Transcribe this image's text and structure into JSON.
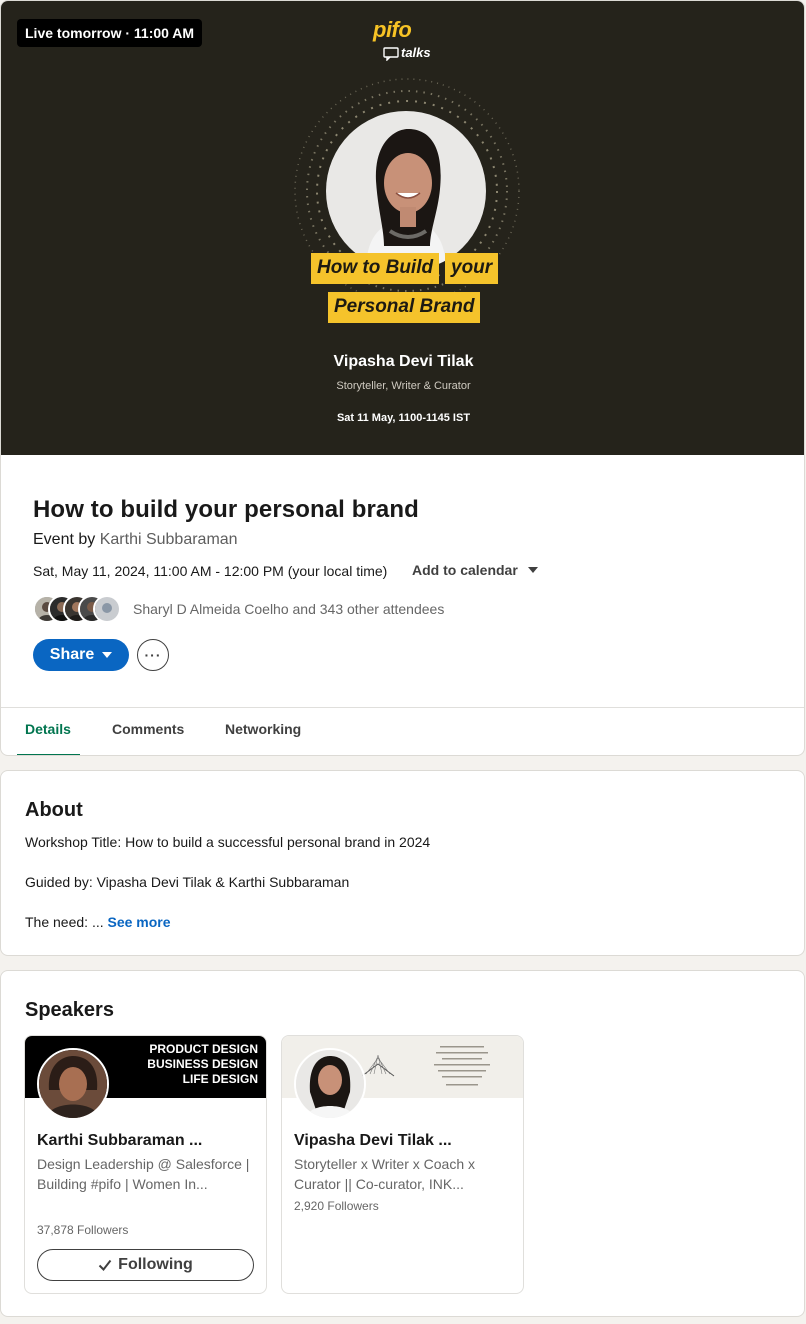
{
  "banner": {
    "live_badge": "Live tomorrow · 11:00 AM",
    "brand_name": "pifo",
    "brand_sub": "talks",
    "headline_line1a": "How to Build",
    "headline_line1b": "your",
    "headline_line2": "Personal Brand",
    "speaker_name": "Vipasha Devi Tilak",
    "speaker_role": "Storyteller, Writer & Curator",
    "date": "Sat 11 May, 1100-1145 IST",
    "colors": {
      "background": "#25231b",
      "accent": "#f5c32b"
    }
  },
  "event": {
    "title": "How to build your personal brand",
    "by_prefix": "Event by",
    "host": "Karthi Subbaraman",
    "time": "Sat, May 11, 2024, 11:00 AM - 12:00 PM (your local time)",
    "add_to_calendar": "Add to calendar",
    "attendees_text": "Sharyl D Almeida Coelho and 343 other attendees",
    "share_label": "Share",
    "more_label": "···"
  },
  "tabs": [
    {
      "label": "Details",
      "active": true
    },
    {
      "label": "Comments",
      "active": false
    },
    {
      "label": "Networking",
      "active": false
    }
  ],
  "about": {
    "title": "About",
    "line1": "Workshop Title: How to build a successful personal brand in 2024",
    "line2": "Guided by: Vipasha Devi Tilak & Karthi Subbaraman",
    "line3_prefix": "The need: ...",
    "see_more": "See more"
  },
  "speakers": {
    "title": "Speakers",
    "items": [
      {
        "name": "Karthi Subbaraman ...",
        "headline": "Design Leadership @ Salesforce | Building #pifo | Women In...",
        "followers": "37,878 Followers",
        "cover_lines": [
          "PRODUCT DESIGN",
          "BUSINESS DESIGN",
          "LIFE DESIGN"
        ],
        "button": "Following"
      },
      {
        "name": "Vipasha Devi Tilak ...",
        "headline": "Storyteller x Writer x Coach x Curator || Co-curator, INK...",
        "followers": "2,920 Followers"
      }
    ]
  }
}
